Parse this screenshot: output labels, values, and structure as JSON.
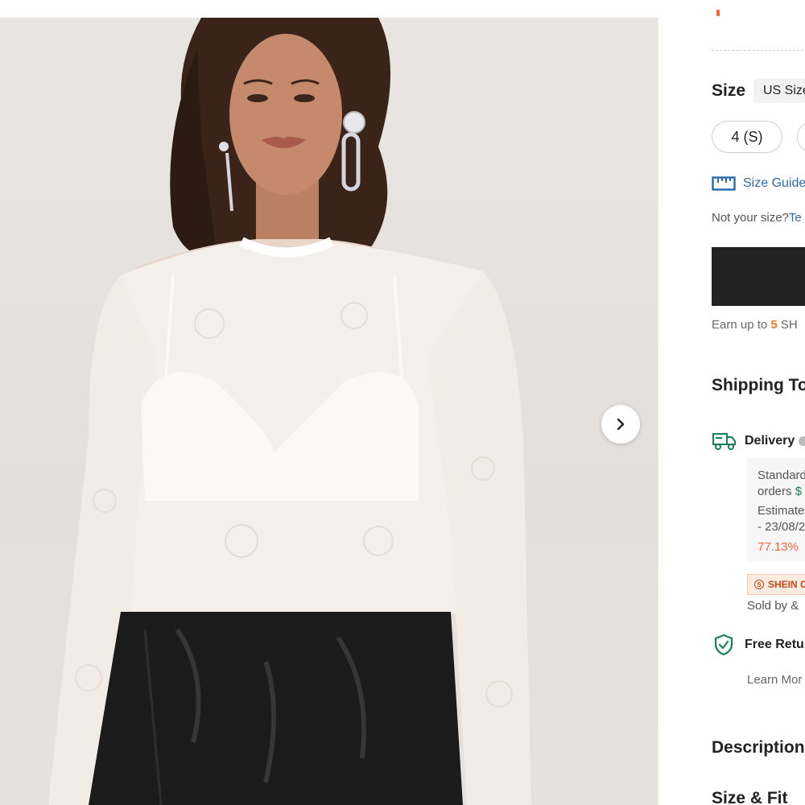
{
  "product": {
    "image_alt": "Model wearing a white sheer lace long-sleeve crop top with a black leather skirt"
  },
  "gallery": {
    "next_icon": "chevron-right-icon"
  },
  "size": {
    "title": "Size",
    "unit_label": "US Size",
    "options": [
      "4 (S)"
    ],
    "guide_label": "Size Guide",
    "not_your_size_prefix": "Not your size?",
    "not_your_size_link": "Te"
  },
  "points": {
    "prefix": "Earn up to ",
    "amount": "5",
    "suffix": " SH"
  },
  "shipping": {
    "title": "Shipping To",
    "delivery_label": "Delivery",
    "line1": "Standard",
    "line2_prefix": "orders ",
    "line2_value": "$",
    "line3": "Estimate",
    "line4": "- 23/08/2",
    "percent": "77.13%",
    "badge": "SHEIN C",
    "sold_by": "Sold by &",
    "returns_label": "Free Retu",
    "learn_more": "Learn Mor"
  },
  "sections": {
    "description": "Description",
    "size_fit": "Size & Fit"
  },
  "colors": {
    "link": "#2d68a8",
    "accent_orange": "#fa6338",
    "points_orange": "#f27b23",
    "green": "#198055",
    "button_dark": "#222222"
  }
}
